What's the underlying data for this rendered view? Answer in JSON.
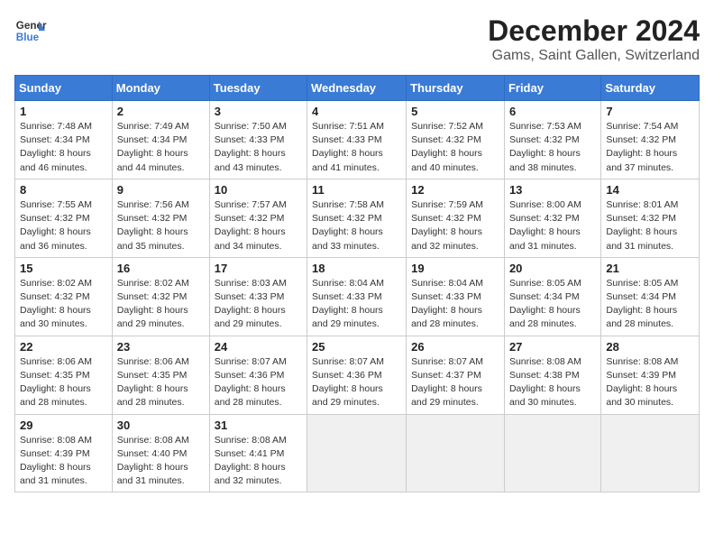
{
  "header": {
    "logo_line1": "General",
    "logo_line2": "Blue",
    "title": "December 2024",
    "subtitle": "Gams, Saint Gallen, Switzerland"
  },
  "days_of_week": [
    "Sunday",
    "Monday",
    "Tuesday",
    "Wednesday",
    "Thursday",
    "Friday",
    "Saturday"
  ],
  "weeks": [
    [
      {
        "num": "1",
        "sunrise": "Sunrise: 7:48 AM",
        "sunset": "Sunset: 4:34 PM",
        "daylight": "Daylight: 8 hours and 46 minutes."
      },
      {
        "num": "2",
        "sunrise": "Sunrise: 7:49 AM",
        "sunset": "Sunset: 4:34 PM",
        "daylight": "Daylight: 8 hours and 44 minutes."
      },
      {
        "num": "3",
        "sunrise": "Sunrise: 7:50 AM",
        "sunset": "Sunset: 4:33 PM",
        "daylight": "Daylight: 8 hours and 43 minutes."
      },
      {
        "num": "4",
        "sunrise": "Sunrise: 7:51 AM",
        "sunset": "Sunset: 4:33 PM",
        "daylight": "Daylight: 8 hours and 41 minutes."
      },
      {
        "num": "5",
        "sunrise": "Sunrise: 7:52 AM",
        "sunset": "Sunset: 4:32 PM",
        "daylight": "Daylight: 8 hours and 40 minutes."
      },
      {
        "num": "6",
        "sunrise": "Sunrise: 7:53 AM",
        "sunset": "Sunset: 4:32 PM",
        "daylight": "Daylight: 8 hours and 38 minutes."
      },
      {
        "num": "7",
        "sunrise": "Sunrise: 7:54 AM",
        "sunset": "Sunset: 4:32 PM",
        "daylight": "Daylight: 8 hours and 37 minutes."
      }
    ],
    [
      {
        "num": "8",
        "sunrise": "Sunrise: 7:55 AM",
        "sunset": "Sunset: 4:32 PM",
        "daylight": "Daylight: 8 hours and 36 minutes."
      },
      {
        "num": "9",
        "sunrise": "Sunrise: 7:56 AM",
        "sunset": "Sunset: 4:32 PM",
        "daylight": "Daylight: 8 hours and 35 minutes."
      },
      {
        "num": "10",
        "sunrise": "Sunrise: 7:57 AM",
        "sunset": "Sunset: 4:32 PM",
        "daylight": "Daylight: 8 hours and 34 minutes."
      },
      {
        "num": "11",
        "sunrise": "Sunrise: 7:58 AM",
        "sunset": "Sunset: 4:32 PM",
        "daylight": "Daylight: 8 hours and 33 minutes."
      },
      {
        "num": "12",
        "sunrise": "Sunrise: 7:59 AM",
        "sunset": "Sunset: 4:32 PM",
        "daylight": "Daylight: 8 hours and 32 minutes."
      },
      {
        "num": "13",
        "sunrise": "Sunrise: 8:00 AM",
        "sunset": "Sunset: 4:32 PM",
        "daylight": "Daylight: 8 hours and 31 minutes."
      },
      {
        "num": "14",
        "sunrise": "Sunrise: 8:01 AM",
        "sunset": "Sunset: 4:32 PM",
        "daylight": "Daylight: 8 hours and 31 minutes."
      }
    ],
    [
      {
        "num": "15",
        "sunrise": "Sunrise: 8:02 AM",
        "sunset": "Sunset: 4:32 PM",
        "daylight": "Daylight: 8 hours and 30 minutes."
      },
      {
        "num": "16",
        "sunrise": "Sunrise: 8:02 AM",
        "sunset": "Sunset: 4:32 PM",
        "daylight": "Daylight: 8 hours and 29 minutes."
      },
      {
        "num": "17",
        "sunrise": "Sunrise: 8:03 AM",
        "sunset": "Sunset: 4:33 PM",
        "daylight": "Daylight: 8 hours and 29 minutes."
      },
      {
        "num": "18",
        "sunrise": "Sunrise: 8:04 AM",
        "sunset": "Sunset: 4:33 PM",
        "daylight": "Daylight: 8 hours and 29 minutes."
      },
      {
        "num": "19",
        "sunrise": "Sunrise: 8:04 AM",
        "sunset": "Sunset: 4:33 PM",
        "daylight": "Daylight: 8 hours and 28 minutes."
      },
      {
        "num": "20",
        "sunrise": "Sunrise: 8:05 AM",
        "sunset": "Sunset: 4:34 PM",
        "daylight": "Daylight: 8 hours and 28 minutes."
      },
      {
        "num": "21",
        "sunrise": "Sunrise: 8:05 AM",
        "sunset": "Sunset: 4:34 PM",
        "daylight": "Daylight: 8 hours and 28 minutes."
      }
    ],
    [
      {
        "num": "22",
        "sunrise": "Sunrise: 8:06 AM",
        "sunset": "Sunset: 4:35 PM",
        "daylight": "Daylight: 8 hours and 28 minutes."
      },
      {
        "num": "23",
        "sunrise": "Sunrise: 8:06 AM",
        "sunset": "Sunset: 4:35 PM",
        "daylight": "Daylight: 8 hours and 28 minutes."
      },
      {
        "num": "24",
        "sunrise": "Sunrise: 8:07 AM",
        "sunset": "Sunset: 4:36 PM",
        "daylight": "Daylight: 8 hours and 28 minutes."
      },
      {
        "num": "25",
        "sunrise": "Sunrise: 8:07 AM",
        "sunset": "Sunset: 4:36 PM",
        "daylight": "Daylight: 8 hours and 29 minutes."
      },
      {
        "num": "26",
        "sunrise": "Sunrise: 8:07 AM",
        "sunset": "Sunset: 4:37 PM",
        "daylight": "Daylight: 8 hours and 29 minutes."
      },
      {
        "num": "27",
        "sunrise": "Sunrise: 8:08 AM",
        "sunset": "Sunset: 4:38 PM",
        "daylight": "Daylight: 8 hours and 30 minutes."
      },
      {
        "num": "28",
        "sunrise": "Sunrise: 8:08 AM",
        "sunset": "Sunset: 4:39 PM",
        "daylight": "Daylight: 8 hours and 30 minutes."
      }
    ],
    [
      {
        "num": "29",
        "sunrise": "Sunrise: 8:08 AM",
        "sunset": "Sunset: 4:39 PM",
        "daylight": "Daylight: 8 hours and 31 minutes."
      },
      {
        "num": "30",
        "sunrise": "Sunrise: 8:08 AM",
        "sunset": "Sunset: 4:40 PM",
        "daylight": "Daylight: 8 hours and 31 minutes."
      },
      {
        "num": "31",
        "sunrise": "Sunrise: 8:08 AM",
        "sunset": "Sunset: 4:41 PM",
        "daylight": "Daylight: 8 hours and 32 minutes."
      },
      null,
      null,
      null,
      null
    ]
  ]
}
